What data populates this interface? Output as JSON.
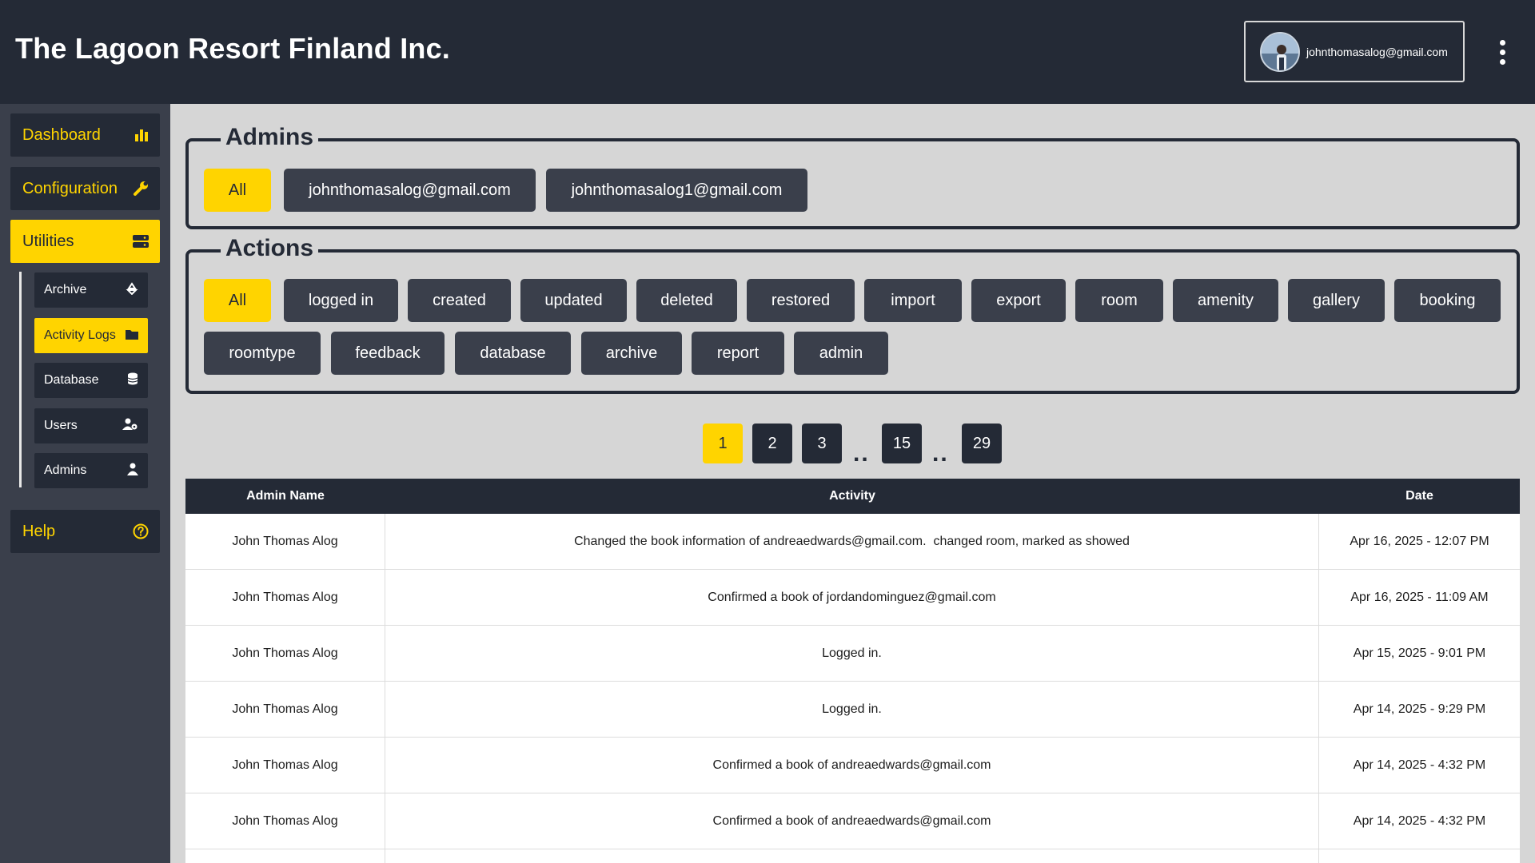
{
  "header": {
    "brand": "The Lagoon Resort Finland Inc.",
    "account_email": "johnthomasalog@gmail.com"
  },
  "sidebar": {
    "nav": [
      {
        "label": "Dashboard",
        "icon": "chart-bar-icon"
      },
      {
        "label": "Configuration",
        "icon": "wrench-icon"
      },
      {
        "label": "Utilities",
        "icon": "server-icon",
        "active": true
      }
    ],
    "sub": [
      {
        "label": "Archive",
        "icon": "recycle-icon"
      },
      {
        "label": "Activity Logs",
        "icon": "folder-icon",
        "active": true
      },
      {
        "label": "Database",
        "icon": "database-icon"
      },
      {
        "label": "Users",
        "icon": "user-gear-icon"
      },
      {
        "label": "Admins",
        "icon": "user-icon"
      }
    ],
    "help": {
      "label": "Help",
      "icon": "question-circle-icon"
    }
  },
  "admins_filter": {
    "legend": "Admins",
    "options": [
      "All",
      "johnthomasalog@gmail.com",
      "johnthomasalog1@gmail.com"
    ],
    "selected": "All"
  },
  "actions_filter": {
    "legend": "Actions",
    "options": [
      "All",
      "logged in",
      "created",
      "updated",
      "deleted",
      "restored",
      "import",
      "export",
      "room",
      "amenity",
      "gallery",
      "booking",
      "roomtype",
      "feedback",
      "database",
      "archive",
      "report",
      "admin"
    ],
    "selected": "All"
  },
  "pagination": {
    "pages": [
      "1",
      "2",
      "3",
      "15",
      "29"
    ],
    "ellipsis": "..",
    "current": "1"
  },
  "table": {
    "headers": [
      "Admin Name",
      "Activity",
      "Date"
    ],
    "rows": [
      {
        "admin": "John Thomas Alog",
        "activity": "Changed the book information of andreaedwards@gmail.com.  changed room, marked as showed",
        "date": "Apr 16, 2025 - 12:07 PM"
      },
      {
        "admin": "John Thomas Alog",
        "activity": "Confirmed a book of jordandominguez@gmail.com",
        "date": "Apr 16, 2025 - 11:09 AM"
      },
      {
        "admin": "John Thomas Alog",
        "activity": "Logged in.",
        "date": "Apr 15, 2025 - 9:01 PM"
      },
      {
        "admin": "John Thomas Alog",
        "activity": "Logged in.",
        "date": "Apr 14, 2025 - 9:29 PM"
      },
      {
        "admin": "John Thomas Alog",
        "activity": "Confirmed a book of andreaedwards@gmail.com",
        "date": "Apr 14, 2025 - 4:32 PM"
      },
      {
        "admin": "John Thomas Alog",
        "activity": "Confirmed a book of andreaedwards@gmail.com",
        "date": "Apr 14, 2025 - 4:32 PM"
      },
      {
        "admin": "",
        "activity": "",
        "date": ""
      }
    ]
  },
  "colors": {
    "header_bg": "#242a36",
    "sidebar_bg": "#3a3f4b",
    "accent": "#ffd400",
    "content_bg": "#d6d6d6"
  }
}
